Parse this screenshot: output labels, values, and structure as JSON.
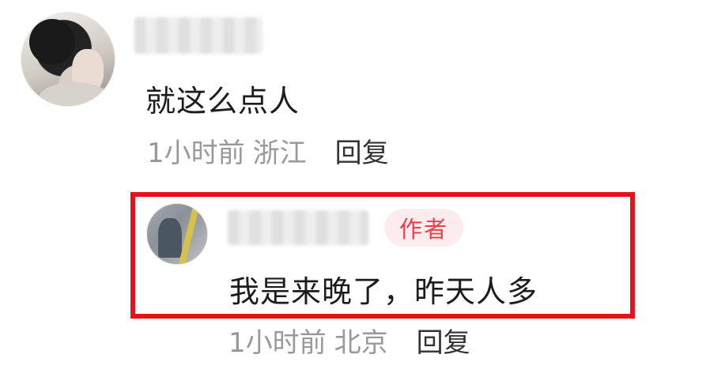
{
  "comment": {
    "username_text": "",
    "text": "就这么点人",
    "time": "1小时前",
    "location": "浙江",
    "reply_label": "回复"
  },
  "reply": {
    "username_text": "",
    "badge": "作者",
    "text": "我是来晚了，昨天人多",
    "time": "1小时前",
    "location": "北京",
    "reply_label": "回复"
  },
  "colors": {
    "highlight_border": "#e8101a",
    "badge_text": "#ef3b4b",
    "badge_bg": "#fdeced",
    "meta_text": "#999999"
  }
}
